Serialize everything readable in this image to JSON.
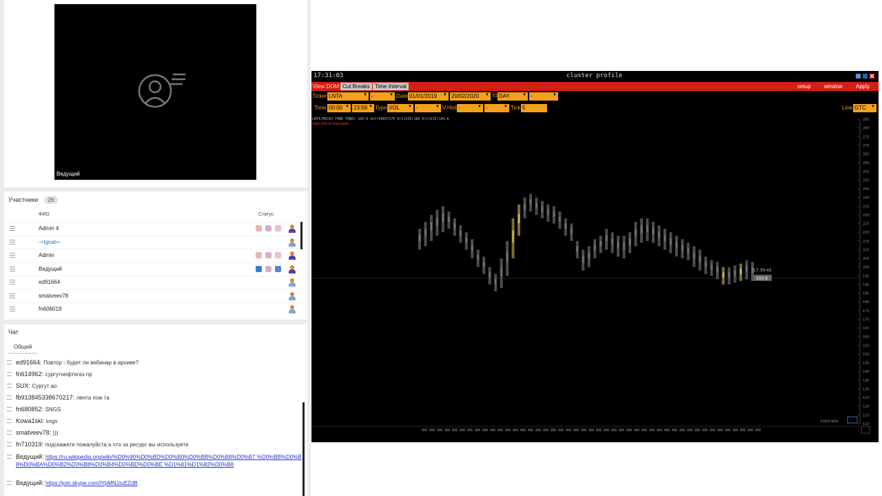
{
  "video": {
    "presenter_label": "Ведущий"
  },
  "participants": {
    "title": "Участники",
    "count": "26",
    "col_name": "ФИО",
    "col_status": "Статус",
    "rows": [
      {
        "name": "Admin 4",
        "link": false,
        "icons": true,
        "mic_on": false,
        "screen_on": false,
        "guest": false
      },
      {
        "name": "-=Ignat=-",
        "link": true,
        "icons": false,
        "guest": true
      },
      {
        "name": "Admin",
        "link": false,
        "icons": true,
        "mic_on": false,
        "screen_on": false,
        "guest": false
      },
      {
        "name": "Ведущий",
        "link": false,
        "icons": true,
        "mic_on": true,
        "screen_on": true,
        "guest": false
      },
      {
        "name": "ed91664",
        "link": false,
        "icons": false,
        "guest": true
      },
      {
        "name": "smatveev78",
        "link": false,
        "icons": false,
        "guest": true
      },
      {
        "name": "fn606019",
        "link": false,
        "icons": false,
        "guest": true
      }
    ]
  },
  "chat": {
    "title": "Чат",
    "tab": "Общий",
    "messages": [
      {
        "author": "ed91664:",
        "text": "Повтор - будет ли вебинар в архиве?",
        "link": ""
      },
      {
        "author": "fn614962:",
        "text": "сургутнефтегаз пр",
        "link": ""
      },
      {
        "author": "SUX:",
        "text": "Сургут ао",
        "link": ""
      },
      {
        "author": "fb913845338670217:",
        "text": "лента пож та",
        "link": ""
      },
      {
        "author": "fn680852:",
        "text": "SNGS",
        "link": ""
      },
      {
        "author": "Kowa1ski:",
        "text": "sngs",
        "link": ""
      },
      {
        "author": "smatveev78:",
        "text": ")))",
        "link": ""
      },
      {
        "author": "fn710319:",
        "text": "подскажите пожалуйста а что за ресурс вы используете",
        "link": ""
      },
      {
        "author": "Ведущий:",
        "text": "",
        "link": "https://ru.wikipedia.org/wiki/%D0%90%D0%BD%D0%B0%D0%BB%D0%B8%D0%B7 %D0%BB%D0%B8%D0%BA%D0%B2%D0%B8%D0%B4%D0%BD%D0%BE %D1%81%D1%82%D0%B8"
      },
      {
        "author": "Ведущий:",
        "text": "",
        "link": "https://join.skype.com/lYpMN1tuEZdB"
      }
    ]
  },
  "terminal": {
    "clock": "17:31:03",
    "title": "cluster profile",
    "menu": {
      "view_dom": "View DOM",
      "cut_breaks": "Cut Breaks",
      "time_interval": "Time Interval",
      "setup": "setup",
      "window": "window",
      "apply": "Apply"
    },
    "row1": {
      "ticker_label": "Ticker",
      "ticker": "LNTA",
      "ticker2": "-",
      "date_label": "Date",
      "date_from": "01/01/2019",
      "date_to": "20/02/2020",
      "tf_label": "TF",
      "tf": "DAY",
      "tf2": "-"
    },
    "row2": {
      "time_label": "Time",
      "time_from": "00:00",
      "time_to": "23:59",
      "type_label": "Type",
      "type": "VOL",
      "type2": "-",
      "vhist_label": "V.Hist",
      "vhist": "-",
      "vhist2": "-",
      "tick_label": "Tick",
      "tick": "5",
      "line_label": "Line",
      "line": "GTC"
    },
    "info_line": "LNTA(MICEX FOND TQBR)  193.6  Vol=39857170  H/L=235/185  O/C=215/193.6",
    "info_line2": "Daily data by Aggregate",
    "last_time": "17:30:42",
    "last_price": "193.6",
    "copyright": "©2020 VolFix",
    "colors": {
      "bar_red": "#d51f14",
      "field_orange": "#f5a01c",
      "label_orange": "#f29a20"
    }
  },
  "chart_data": {
    "type": "bar",
    "title": "",
    "note": "daily price ranges (cluster profile), approximate",
    "ylim": [
      110,
      285
    ],
    "y_ticks": [
      285,
      280,
      275,
      270,
      265,
      260,
      255,
      250,
      245,
      240,
      235,
      230,
      225,
      220,
      215,
      210,
      205,
      200,
      195,
      190,
      185,
      180,
      175,
      170,
      165,
      160,
      155,
      150,
      145,
      140,
      135,
      130,
      125,
      120,
      115,
      110
    ],
    "series": [
      {
        "values_low": [
          210,
          212,
          215,
          218,
          220,
          222,
          218,
          214,
          210,
          205,
          200,
          196,
          190,
          186,
          188,
          195,
          205,
          218,
          228,
          232,
          230,
          228,
          226,
          225,
          222,
          218,
          215,
          205,
          198,
          200,
          205,
          208,
          210,
          208,
          206,
          205,
          208,
          212,
          214,
          215,
          214,
          212,
          210,
          208,
          206,
          205,
          204,
          200,
          198,
          196,
          195,
          193,
          190,
          190,
          191,
          192,
          193,
          192
        ],
        "values_high": [
          222,
          226,
          230,
          233,
          235,
          232,
          228,
          224,
          220,
          216,
          210,
          206,
          200,
          196,
          205,
          215,
          228,
          236,
          240,
          242,
          240,
          238,
          236,
          235,
          232,
          228,
          225,
          215,
          210,
          212,
          216,
          218,
          222,
          220,
          218,
          218,
          220,
          226,
          228,
          228,
          226,
          224,
          222,
          220,
          218,
          216,
          214,
          212,
          210,
          206,
          204,
          203,
          200,
          200,
          201,
          202,
          204,
          203
        ]
      }
    ],
    "last_value": 193.6
  }
}
